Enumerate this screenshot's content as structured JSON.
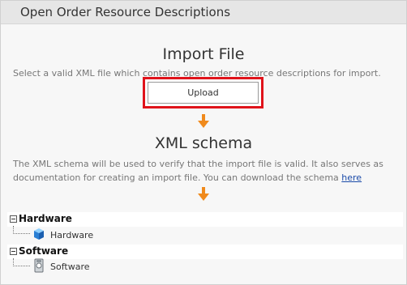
{
  "header": {
    "title": "Open Order Resource Descriptions"
  },
  "import": {
    "title": "Import File",
    "description": "Select a valid XML file which contains open order resource descriptions for import.",
    "upload_label": "Upload"
  },
  "schema": {
    "title": "XML schema",
    "description_line1": "The XML schema will be used to verify that the import file is valid. It also serves as",
    "description_line2": "documentation for creating an import file. You can download the schema ",
    "link_label": "here"
  },
  "tree": {
    "groups": [
      {
        "label": "Hardware",
        "child": "Hardware",
        "icon": "cube-icon"
      },
      {
        "label": "Software",
        "child": "Software",
        "icon": "software-disk-icon"
      }
    ]
  },
  "colors": {
    "highlight": "#e0131b",
    "arrow": "#f08a1c",
    "link": "#1a4aa8"
  }
}
